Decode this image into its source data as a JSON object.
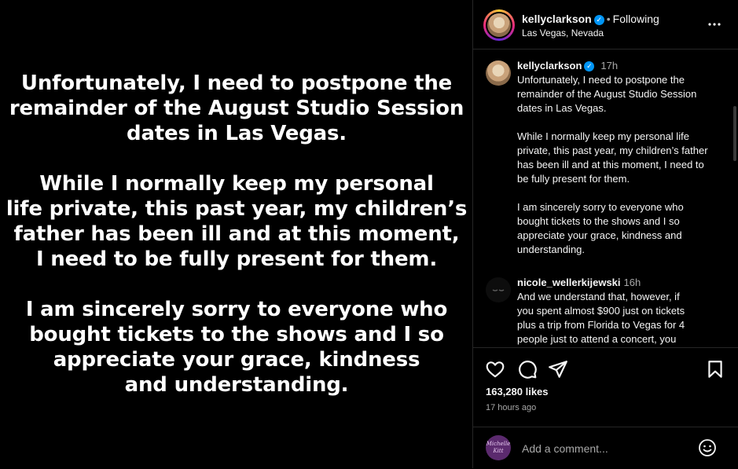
{
  "post": {
    "image_text": [
      "Unfortunately, I need to postpone the\nremainder of the August Studio Session\ndates in Las Vegas.",
      "While I normally keep my personal\nlife private, this past year, my children’s\nfather has been ill and at this moment,\nI need to be fully present for them.",
      "I am sincerely sorry to everyone who\nbought tickets to the shows and I so\nappreciate your grace, kindness\nand understanding."
    ]
  },
  "header": {
    "username": "kellyclarkson",
    "verified_mark": "✓",
    "separator": "•",
    "follow_status": "Following",
    "location": "Las Vegas, Nevada",
    "more_icon": "more-horizontal-icon"
  },
  "caption": {
    "username": "kellyclarkson",
    "verified_mark": "✓",
    "time": "17h",
    "paragraphs": [
      "Unfortunately, I need to postpone the\nremainder of the August Studio Session\ndates in Las Vegas.",
      "While I normally keep my personal life\nprivate, this past year, my children’s father\nhas been ill and at this moment, I need to\nbe fully present for them.",
      "I am sincerely sorry to everyone who\nbought tickets to the shows and I so\nappreciate your grace, kindness and\nunderstanding."
    ]
  },
  "comments": [
    {
      "username": "nicole_wellerkijewski",
      "time": "16h",
      "text": "And we understand that, however, if\nyou spent almost $900 just on tickets\nplus a trip from Florida to Vegas for 4\npeople just to attend a concert, you"
    }
  ],
  "actions": {
    "icons": [
      "heart-icon",
      "comment-icon",
      "share-icon",
      "bookmark-icon"
    ],
    "likes": "163,280 likes",
    "time_ago": "17 hours ago"
  },
  "add_comment": {
    "avatar_text": "Michelle\nKitt",
    "placeholder": "Add a comment...",
    "emoji_icon": "smiley-icon"
  },
  "colors": {
    "background": "#000000",
    "text": "#f5f5f5",
    "muted": "#a8a8a8",
    "verified": "#0095f6",
    "divider": "#262626"
  }
}
